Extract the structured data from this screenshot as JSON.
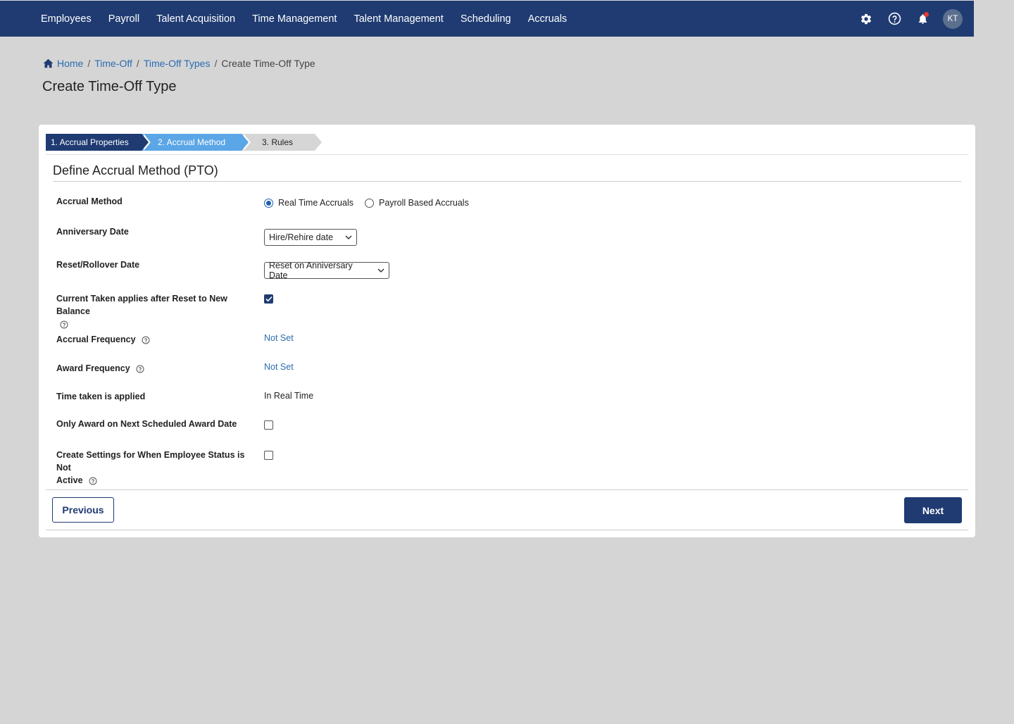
{
  "nav": {
    "items": [
      {
        "label": "Employees"
      },
      {
        "label": "Payroll"
      },
      {
        "label": "Talent Acquisition"
      },
      {
        "label": "Time Management"
      },
      {
        "label": "Talent Management"
      },
      {
        "label": "Scheduling"
      },
      {
        "label": "Accruals"
      }
    ],
    "icons": [
      "gear-icon",
      "help-icon",
      "bell-icon"
    ],
    "avatar_initials": "KT",
    "notification_dot_color": "#e53935",
    "bar_color": "#1f3b72"
  },
  "breadcrumb": {
    "home": "Home",
    "time_off": "Time-Off",
    "time_off_types": "Time-Off Types",
    "current": "Create Time-Off Type"
  },
  "page_title": "Create Time-Off Type",
  "stepper": {
    "steps": [
      {
        "label": "1. Accrual Properties",
        "state": "completed"
      },
      {
        "label": "2. Accrual Method",
        "state": "active"
      },
      {
        "label": "3. Rules",
        "state": "pending"
      }
    ]
  },
  "form": {
    "section_title": "Define Accrual Method (PTO)",
    "accrual_method": {
      "label": "Accrual Method",
      "options": [
        {
          "label": "Real Time Accruals",
          "checked": true
        },
        {
          "label": "Payroll Based Accruals",
          "checked": false
        }
      ]
    },
    "anniversary_date": {
      "label": "Anniversary Date",
      "value": "Hire/Rehire date"
    },
    "reset_rollover_date": {
      "label": "Reset/Rollover Date",
      "value": "Reset on Anniversary Date"
    },
    "current_taken": {
      "label": "Current Taken applies after Reset to New Balance",
      "checked": true
    },
    "accrual_frequency": {
      "label": "Accrual Frequency",
      "value": "Not Set"
    },
    "award_frequency": {
      "label": "Award Frequency",
      "value": "Not Set"
    },
    "time_taken_applied": {
      "label": "Time taken is applied",
      "value": "In Real Time"
    },
    "only_award_next": {
      "label": "Only Award on Next Scheduled Award Date",
      "checked": false
    },
    "inactive_settings": {
      "label_line1": "Create Settings for When Employee Status is Not",
      "label_line2": "Active",
      "checked": false
    }
  },
  "footer": {
    "previous_label": "Previous",
    "next_label": "Next"
  }
}
